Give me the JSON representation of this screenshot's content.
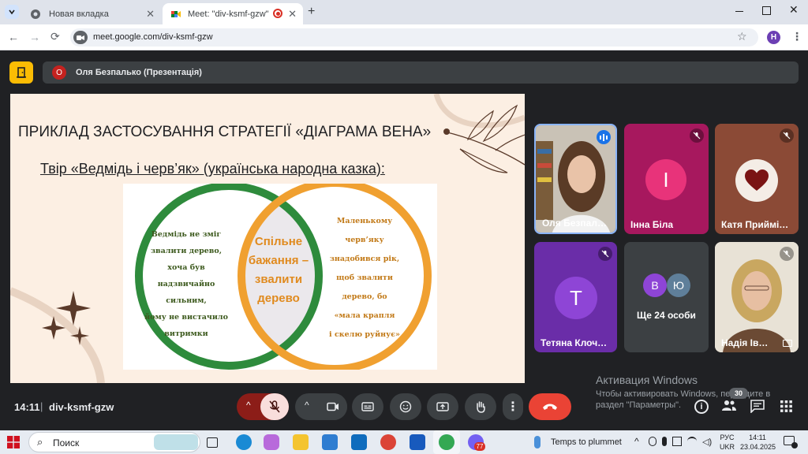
{
  "browser": {
    "tabs": [
      {
        "title": "Новая вкладка",
        "active": false
      },
      {
        "title": "Meet: \"div-ksmf-gzw\"",
        "active": true
      }
    ],
    "url": "meet.google.com/div-ksmf-gzw",
    "profile_initial": "H"
  },
  "meet": {
    "presenter_initial": "О",
    "presenter_label": "Оля Безпалько (Презентація)",
    "slide": {
      "title": "ПРИКЛАД ЗАСТОСУВАННЯ СТРАТЕГІЇ «ДІАГРАМА ВЕНА»",
      "subtitle": "Твір «Ведмідь і черв’як» (українська народна казка):",
      "left_circle": [
        "Ведмідь не зміг",
        "звалити дерево,",
        "хоча був",
        "надзвичайно сильним,",
        "йому не вистачило",
        "витримки"
      ],
      "center": [
        "Спільне",
        "бажання –",
        "звалити",
        "дерево"
      ],
      "right_circle": [
        "Маленькому",
        "черв’яку",
        "знадобився рік,",
        "щоб звалити",
        "дерево, бо",
        "«мала крапля",
        "і скелю руйнує»"
      ]
    },
    "participants": [
      {
        "name": "Оля Безпал…",
        "type": "video"
      },
      {
        "name": "Інна Біла",
        "initial": "І",
        "type": "avatar"
      },
      {
        "name": "Катя Приймі…",
        "type": "heart"
      },
      {
        "name": "Тетяна Клоч…",
        "initial": "Т",
        "type": "avatar"
      },
      {
        "name": "Ще 24 особи",
        "initials": [
          "В",
          "Ю"
        ],
        "type": "more"
      },
      {
        "name": "Надія Ів…",
        "type": "video"
      }
    ],
    "bottom": {
      "time": "14:11",
      "separator": "|",
      "meeting_code": "div-ksmf-gzw",
      "people_count": "30"
    }
  },
  "activation": {
    "title": "Активация Windows",
    "line1": "Чтобы активировать Windows, перейдите в",
    "line2": "раздел \"Параметры\"."
  },
  "taskbar": {
    "search_placeholder": "Поиск",
    "weather": "Temps to plummet",
    "lang_top": "РУС",
    "lang_bottom": "UKR",
    "time": "14:11",
    "date": "23.04.2025",
    "viber_badge": "77"
  },
  "colors": {
    "accent_green": "#2e8b3c",
    "accent_orange": "#f0a030",
    "meet_red": "#ea4335",
    "meet_bg": "#202124"
  }
}
